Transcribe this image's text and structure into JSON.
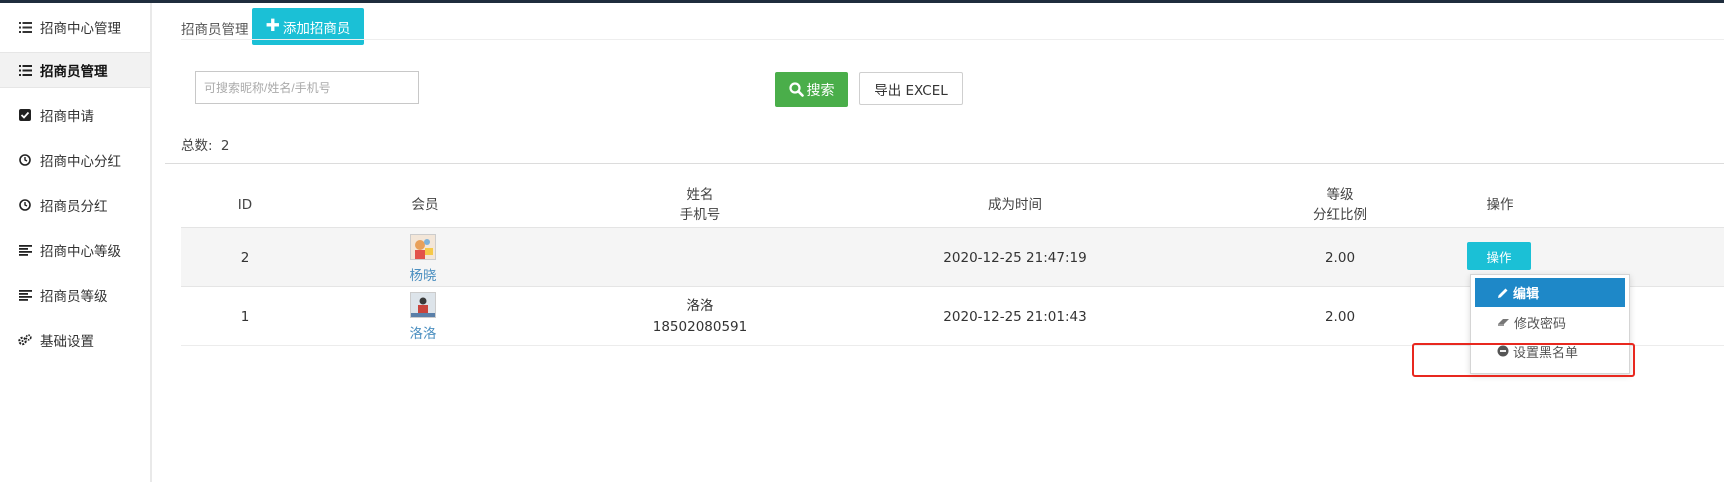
{
  "sidebar": {
    "items": [
      {
        "label": "招商中心管理",
        "icon": "list-icon"
      },
      {
        "label": "招商员管理",
        "icon": "list-icon"
      },
      {
        "label": "招商申请",
        "icon": "checkbox-icon"
      },
      {
        "label": "招商中心分红",
        "icon": "clock-icon"
      },
      {
        "label": "招商员分红",
        "icon": "clock-icon"
      },
      {
        "label": "招商中心等级",
        "icon": "align-left-icon"
      },
      {
        "label": "招商员等级",
        "icon": "align-left-icon"
      },
      {
        "label": "基础设置",
        "icon": "gears-icon"
      }
    ],
    "active_index": 1
  },
  "header": {
    "title": "招商员管理",
    "add_button": "添加招商员"
  },
  "search": {
    "placeholder": "可搜索昵称/姓名/手机号",
    "value": "",
    "search_button": "搜索",
    "export_button": "导出 EXCEL"
  },
  "summary": {
    "total_label": "总数:",
    "total_value": "2"
  },
  "table": {
    "headers": {
      "id": "ID",
      "member": "会员",
      "name": "姓名",
      "phone": "手机号",
      "time": "成为时间",
      "level": "等级",
      "ratio": "分红比例",
      "ops": "操作"
    },
    "rows": [
      {
        "id": "2",
        "member": "杨晓",
        "name": "",
        "phone": "",
        "time": "2020-12-25 21:47:19",
        "ratio": "2.00",
        "op": "操作"
      },
      {
        "id": "1",
        "member": "洛洛",
        "name": "洛洛",
        "phone": "18502080591",
        "time": "2020-12-25 21:01:43",
        "ratio": "2.00"
      }
    ]
  },
  "dropdown": {
    "items": [
      {
        "label": "编辑",
        "icon": "pencil-icon"
      },
      {
        "label": "修改密码",
        "icon": "eraser-icon"
      },
      {
        "label": "设置黑名单",
        "icon": "minus-circle-icon"
      }
    ]
  },
  "colors": {
    "accent": "#1bc0d6",
    "success": "#4aae4a",
    "dropdown_active": "#1e88c8",
    "highlight": "#e8281f",
    "link": "#4b8fc0"
  }
}
